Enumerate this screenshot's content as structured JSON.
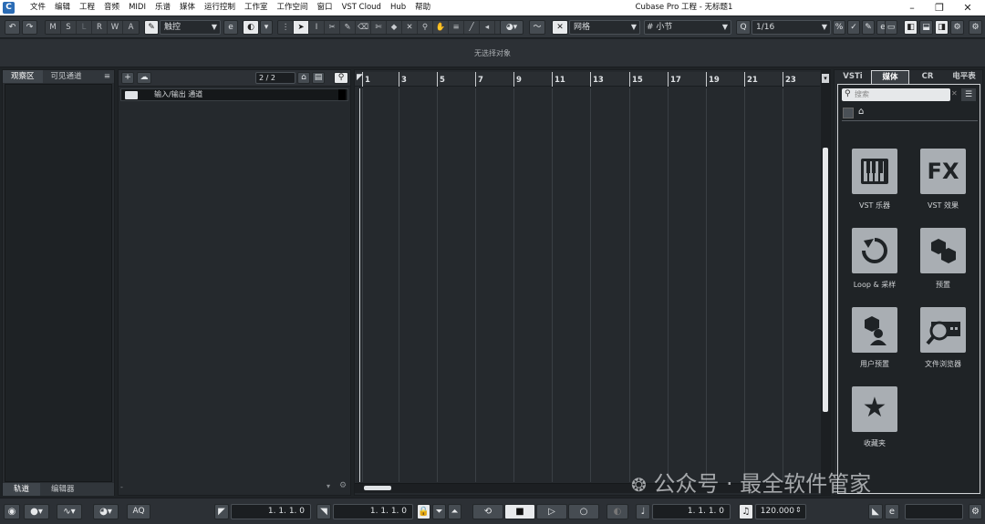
{
  "app": {
    "title": "Cubase Pro 工程 - 无标题1",
    "logo": "C",
    "menu": [
      "文件",
      "编辑",
      "工程",
      "音频",
      "MIDI",
      "乐谱",
      "媒体",
      "运行控制",
      "工作室",
      "工作空间",
      "窗口",
      "VST Cloud",
      "Hub",
      "帮助"
    ]
  },
  "toolbar": {
    "msl": [
      "M",
      "S",
      "L",
      "R",
      "W",
      "A"
    ],
    "touch_mode": "触控",
    "grid_type": "网格",
    "grid_unit": "小节",
    "quantize": "1/16"
  },
  "info_line": "无选择对象",
  "left_panel": {
    "tabs": [
      "观察区",
      "可见通道"
    ],
    "bottom_tabs": [
      "轨道",
      "编辑器"
    ]
  },
  "track_list": {
    "counter": "2 / 2",
    "folder_name": "输入/输出 通道"
  },
  "ruler": {
    "bars": [
      "1",
      "3",
      "5",
      "7",
      "9",
      "11",
      "13",
      "15",
      "17",
      "19",
      "21",
      "23"
    ]
  },
  "right_panel": {
    "tabs": [
      "VSTi",
      "媒体",
      "CR",
      "电平表"
    ],
    "search_placeholder": "搜索",
    "tiles": [
      {
        "label": "VST 乐器",
        "icon": "piano-icon"
      },
      {
        "label": "VST 效果",
        "icon": "fx-icon",
        "glyph": "FX"
      },
      {
        "label": "Loop & 采样",
        "icon": "loop-icon"
      },
      {
        "label": "预置",
        "icon": "preset-icon"
      },
      {
        "label": "用户预置",
        "icon": "user-preset-icon"
      },
      {
        "label": "文件浏览器",
        "icon": "file-browser-icon"
      },
      {
        "label": "收藏夹",
        "icon": "favorites-icon",
        "glyph": "★"
      }
    ]
  },
  "transport": {
    "aq": "AQ",
    "left_locator": "1. 1. 1. 0",
    "right_locator": "1. 1. 1. 0",
    "position": "1. 1. 1. 0",
    "tempo": "120.000"
  },
  "watermark": "公众号 · 最全软件管家"
}
